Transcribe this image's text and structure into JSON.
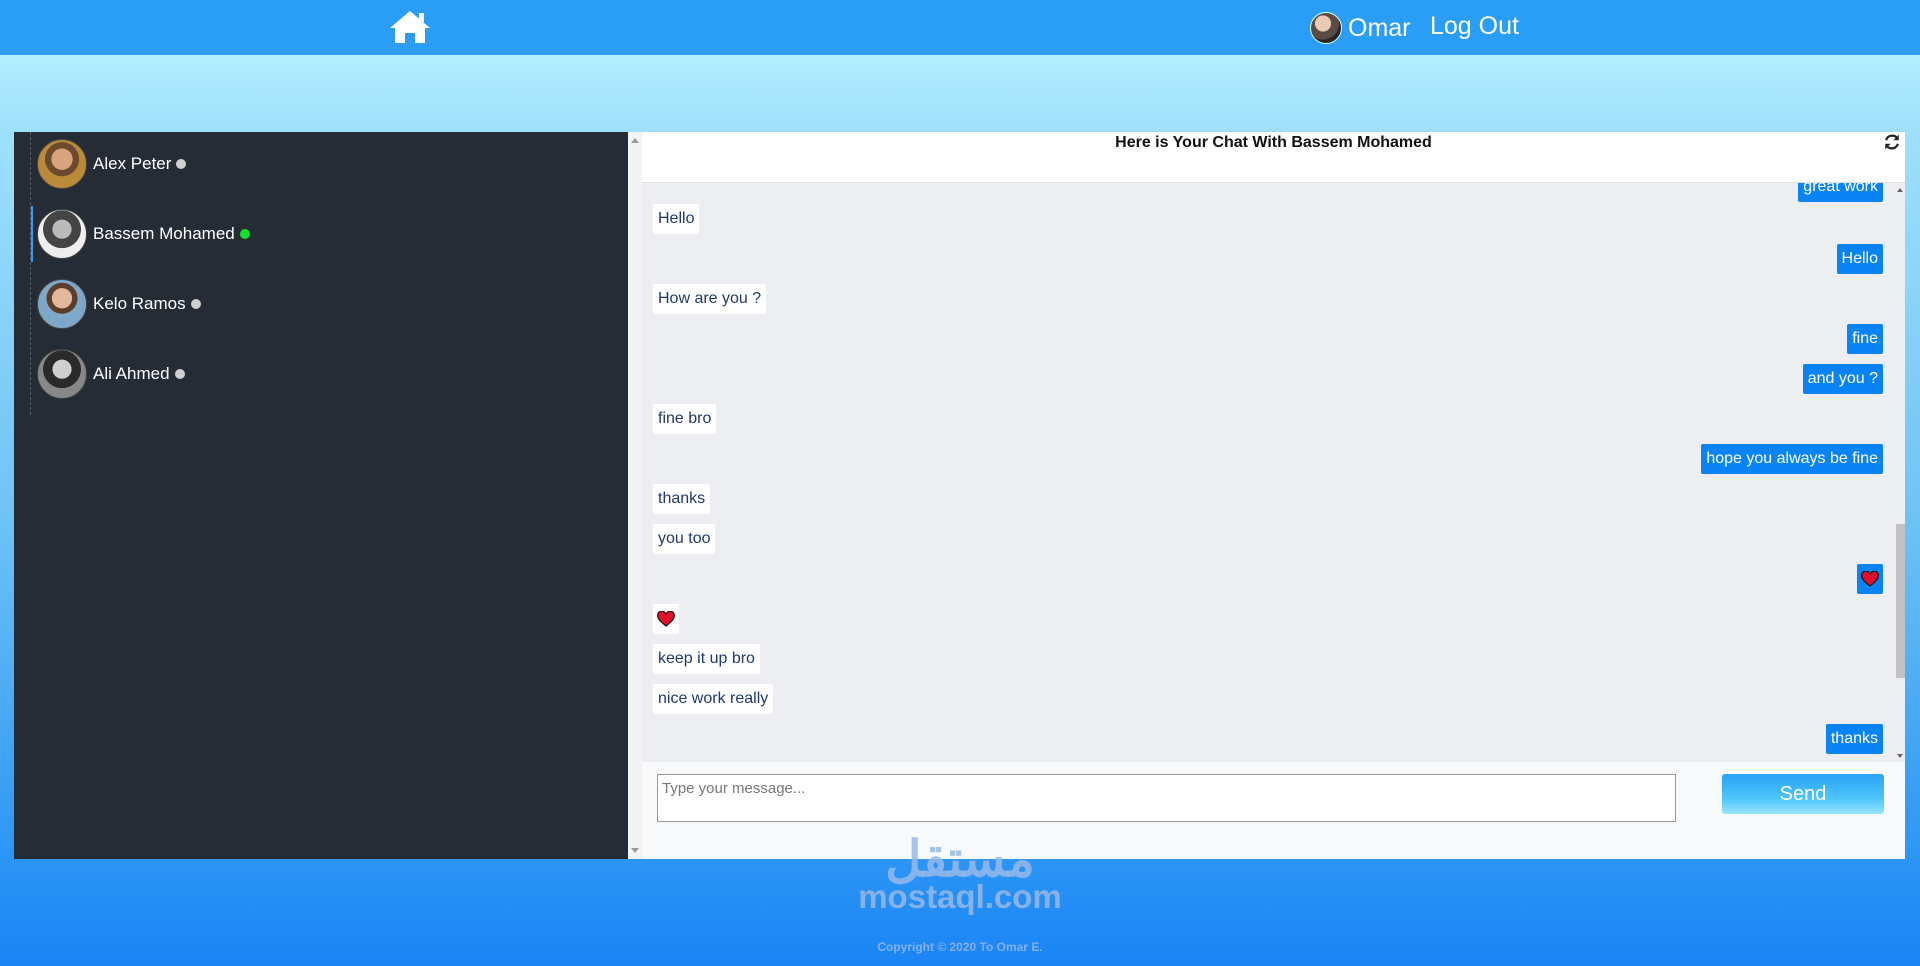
{
  "nav": {
    "user_name": "Omar",
    "logout_label": "Log Out",
    "home_icon": "home-icon",
    "avatar": "avatar"
  },
  "contacts": [
    {
      "name": "Alex Peter",
      "online": false
    },
    {
      "name": "Bassem Mohamed",
      "online": true,
      "active": true
    },
    {
      "name": "Kelo Ramos",
      "online": false
    },
    {
      "name": "Ali Ahmed",
      "online": false
    }
  ],
  "chat": {
    "title": "Here is Your Chat With Bassem Mohamed",
    "messages": [
      {
        "dir": "out",
        "text": "great work"
      },
      {
        "dir": "in",
        "text": "Hello"
      },
      {
        "dir": "out",
        "text": "Hello"
      },
      {
        "dir": "in",
        "text": "How are you ?"
      },
      {
        "dir": "out",
        "text": "fine"
      },
      {
        "dir": "out",
        "text": "and you ?"
      },
      {
        "dir": "in",
        "text": "fine bro"
      },
      {
        "dir": "out",
        "text": "hope you always be fine"
      },
      {
        "dir": "in",
        "text": "thanks"
      },
      {
        "dir": "in",
        "text": "you too"
      },
      {
        "dir": "out",
        "icon": "heart-icon"
      },
      {
        "dir": "in",
        "icon": "heart-icon"
      },
      {
        "dir": "in",
        "text": "keep it up bro"
      },
      {
        "dir": "in",
        "text": "nice work really"
      },
      {
        "dir": "out",
        "text": "thanks"
      }
    ],
    "composer_placeholder": "Type your message...",
    "send_label": "Send"
  },
  "footer": {
    "watermark_ar": "مستقل",
    "watermark_en": "mostaql.com",
    "copyright": "Copyright © 2020 To Omar E."
  },
  "colors": {
    "nav_bg": "#2a9df7",
    "sidebar_bg": "#262c36",
    "outgoing_bubble": "#0a84f5",
    "incoming_text": "#1d3a6b",
    "online_dot": "#14e02a"
  }
}
